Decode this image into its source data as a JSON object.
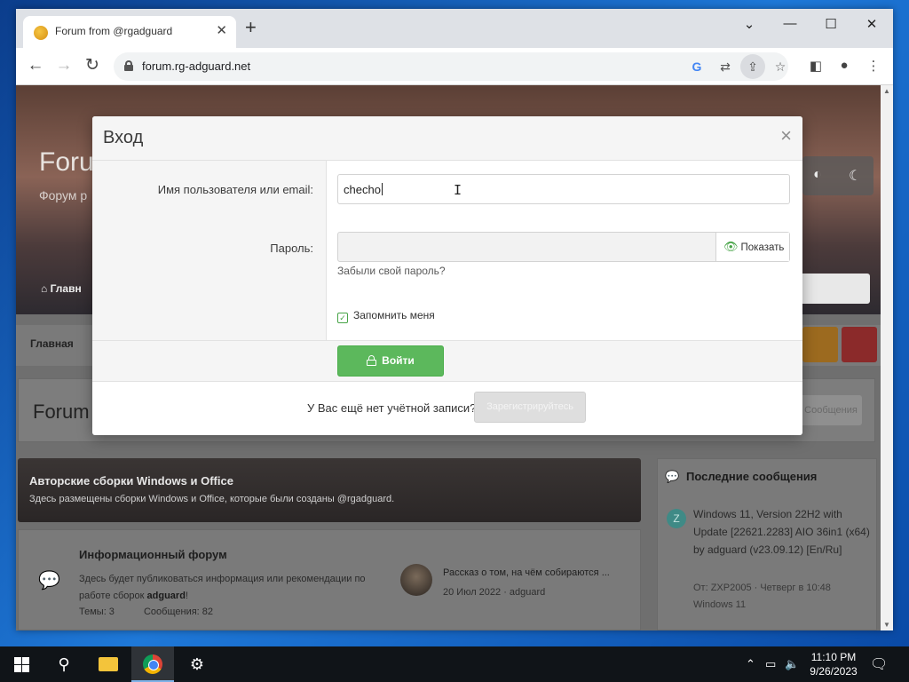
{
  "browser": {
    "tab_title": "Forum from @rgadguard",
    "url": "forum.rg-adguard.net",
    "new_tab_symbol": "+",
    "minimize_symbol": "—",
    "maximize_symbol": "☐",
    "close_symbol": "✕",
    "collapse_symbol": "⌄"
  },
  "page": {
    "hero_title": "Forum",
    "hero_subtitle": "Форум p",
    "hero_nav_home": "Главн",
    "breadcrumb": "Главная",
    "forum_header_title": "Forum",
    "forum_header_button": "Сообщения",
    "category": {
      "title": "Авторские сборки Windows и Office",
      "description": "Здесь размещены сборки Windows и Office, которые были созданы @rgadguard."
    },
    "forum": {
      "name": "Информационный форум",
      "description_part1": "Здесь будет публиковаться информация или рекомендации по работе сборок ",
      "description_bold": "adguard",
      "description_part2": "!",
      "threads": "Темы: 3",
      "messages": "Сообщения: 82",
      "latest_title": "Рассказ о том, на чём собираются ...",
      "latest_meta": "20 Июл 2022 · adguard"
    },
    "sidebar": {
      "title": "Последние сообщения",
      "avatar_letter": "Z",
      "post_title": "Windows 11, Version 22H2 with Update [22621.2283] AIO 36in1 (x64) by adguard (v23.09.12) [En/Ru]",
      "post_meta": "От: ZXP2005 · Четверг в 10:48",
      "post_forum": "Windows 11"
    }
  },
  "modal": {
    "title": "Вход",
    "close_symbol": "×",
    "username_label": "Имя пользователя или email:",
    "username_value": "checho",
    "password_label": "Пароль:",
    "password_value": "",
    "show_button": "Показать",
    "forgot_link": "Забыли свой пароль?",
    "remember_label": "Запомнить меня",
    "remember_checked": true,
    "login_button": "Войти",
    "no_account_text": "У Вас ещё нет учётной записи?",
    "register_button": "Зарегистрируйтесь"
  },
  "taskbar": {
    "time": "11:10 PM",
    "date": "9/26/2023"
  },
  "colors": {
    "success": "#5cb85c",
    "modal_header_bg": "#f5f5f5",
    "desktop_blue": "#1a6fc4"
  }
}
